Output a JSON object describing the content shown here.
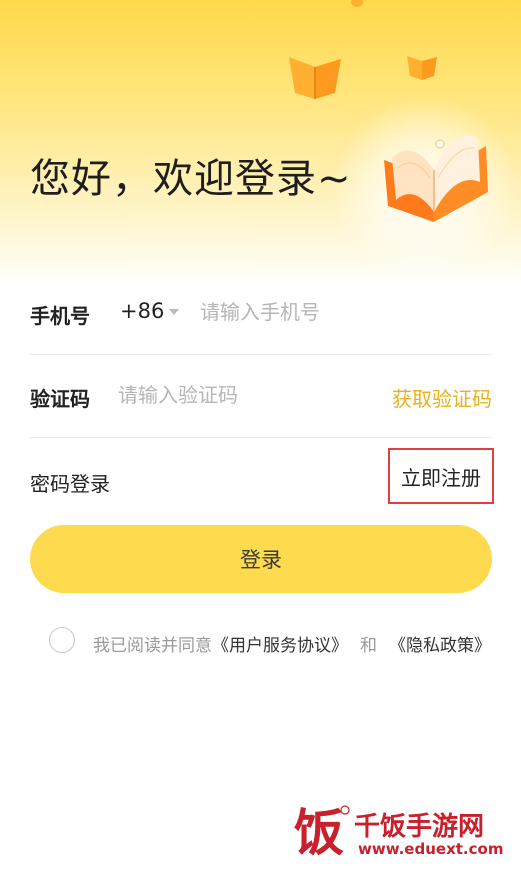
{
  "hero": {
    "greeting": "您好，欢迎登录~"
  },
  "phone_row": {
    "label": "手机号",
    "country_code": "+86",
    "placeholder": "请输入手机号",
    "value": ""
  },
  "code_row": {
    "label": "验证码",
    "placeholder": "请输入验证码",
    "value": "",
    "get_code": "获取验证码"
  },
  "links": {
    "password_login": "密码登录",
    "register": "立即注册"
  },
  "login_button": "登录",
  "agreement": {
    "checked": false,
    "prefix": "我已阅读并同意",
    "user_agreement": "《用户服务协议》",
    "and": "和",
    "privacy_policy": "《隐私政策》"
  },
  "watermark": {
    "logo_char": "饭",
    "title": "千饭手游网",
    "url": "www.eduext.com"
  },
  "colors": {
    "accent_yellow": "#fdda4e",
    "get_code_text": "#e8b21c",
    "highlight_border": "#e0413f",
    "watermark_red": "#c8202c"
  }
}
